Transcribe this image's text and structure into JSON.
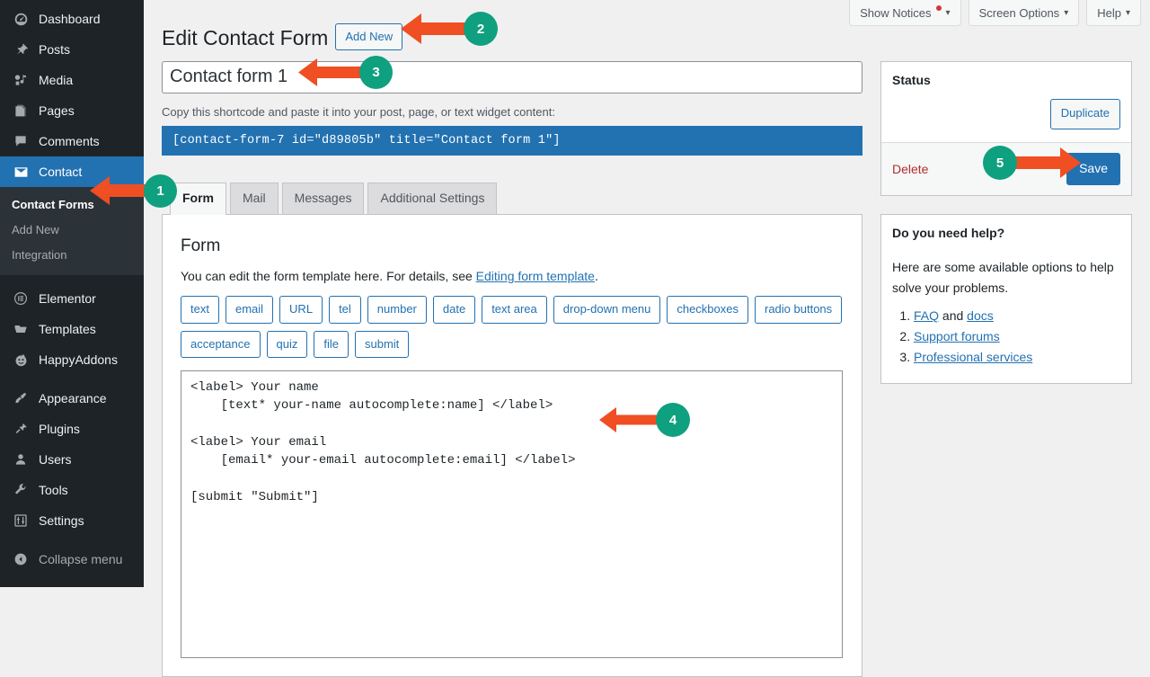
{
  "sidebar": {
    "items": [
      {
        "label": "Dashboard",
        "icon": "dashboard-icon"
      },
      {
        "label": "Posts",
        "icon": "pin-icon"
      },
      {
        "label": "Media",
        "icon": "media-icon"
      },
      {
        "label": "Pages",
        "icon": "pages-icon"
      },
      {
        "label": "Comments",
        "icon": "comments-icon"
      },
      {
        "label": "Contact",
        "icon": "envelope-icon"
      },
      {
        "label": "Elementor",
        "icon": "elementor-icon"
      },
      {
        "label": "Templates",
        "icon": "folder-icon"
      },
      {
        "label": "HappyAddons",
        "icon": "happyaddons-icon"
      },
      {
        "label": "Appearance",
        "icon": "brush-icon"
      },
      {
        "label": "Plugins",
        "icon": "plug-icon"
      },
      {
        "label": "Users",
        "icon": "user-icon"
      },
      {
        "label": "Tools",
        "icon": "wrench-icon"
      },
      {
        "label": "Settings",
        "icon": "sliders-icon"
      },
      {
        "label": "Collapse menu",
        "icon": "collapse-icon"
      }
    ],
    "submenu": [
      {
        "label": "Contact Forms",
        "current": true
      },
      {
        "label": "Add New",
        "current": false
      },
      {
        "label": "Integration",
        "current": false
      }
    ]
  },
  "screen_meta": {
    "show_notices": "Show Notices",
    "screen_options": "Screen Options",
    "help": "Help",
    "caret": "▾",
    "notice_dot_color": "#d63638"
  },
  "header": {
    "title": "Edit Contact Form",
    "add_new": "Add New"
  },
  "form": {
    "title_value": "Contact form 1",
    "shortcode_label": "Copy this shortcode and paste it into your post, page, or text widget content:",
    "shortcode_value": "[contact-form-7 id=\"d89805b\" title=\"Contact form 1\"]",
    "tabs": [
      {
        "label": "Form",
        "active": true
      },
      {
        "label": "Mail",
        "active": false
      },
      {
        "label": "Messages",
        "active": false
      },
      {
        "label": "Additional Settings",
        "active": false
      }
    ],
    "panel_title": "Form",
    "panel_desc_before": "You can edit the form template here. For details, see ",
    "panel_desc_link": "Editing form template",
    "panel_desc_after": ".",
    "tag_row_1": [
      "text",
      "email",
      "URL",
      "tel",
      "number",
      "date",
      "text area",
      "drop-down menu",
      "checkboxes",
      "radio buttons"
    ],
    "tag_row_2": [
      "acceptance",
      "quiz",
      "file",
      "submit"
    ],
    "code": "<label> Your name\n    [text* your-name autocomplete:name] </label>\n\n<label> Your email\n    [email* your-email autocomplete:email] </label>\n\n[submit \"Submit\"]"
  },
  "status_box": {
    "heading": "Status",
    "duplicate": "Duplicate",
    "delete": "Delete",
    "save": "Save"
  },
  "help_box": {
    "heading": "Do you need help?",
    "intro": "Here are some available options to help solve your problems.",
    "items": [
      {
        "prefix": "",
        "link1": "FAQ",
        "middle": " and ",
        "link2": "docs"
      },
      {
        "prefix": "",
        "link1": "Support forums",
        "middle": "",
        "link2": ""
      },
      {
        "prefix": "",
        "link1": "Professional services",
        "middle": "",
        "link2": ""
      }
    ]
  },
  "annotations": {
    "arrow_color": "#f04e23",
    "badge_color": "#0fa080",
    "markers": [
      {
        "number": "1",
        "target": "sidebar-item-contact"
      },
      {
        "number": "2",
        "target": "add-new-button"
      },
      {
        "number": "3",
        "target": "form-title-input"
      },
      {
        "number": "4",
        "target": "form-code-textarea"
      },
      {
        "number": "5",
        "target": "save-button"
      }
    ]
  }
}
